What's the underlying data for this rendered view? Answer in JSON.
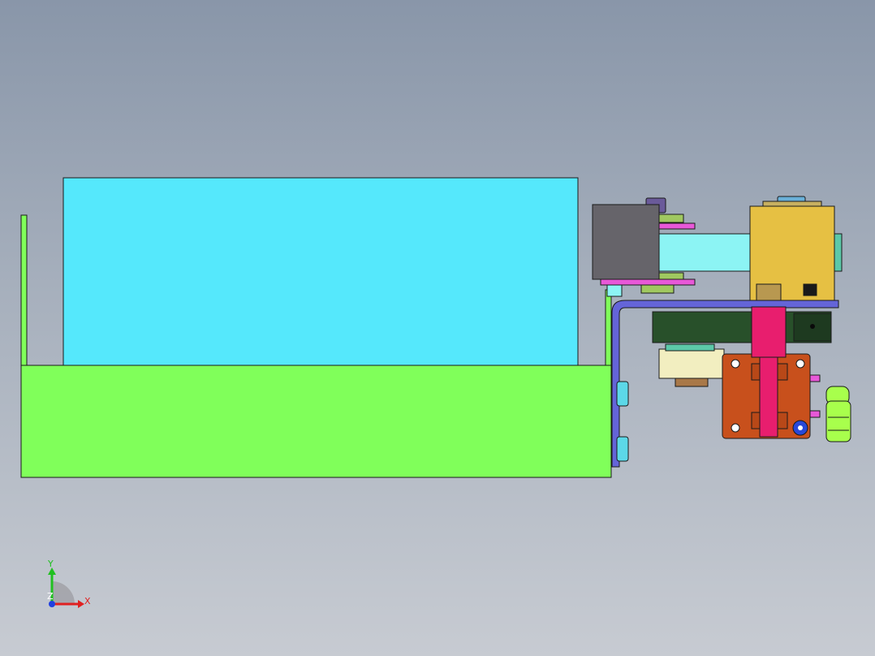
{
  "viewport": {
    "background_top": "#8996a9",
    "background_bottom": "#c7cbd2"
  },
  "triad": {
    "x_label": "X",
    "y_label": "Y",
    "z_label": "Z",
    "x_color": "#e02020",
    "y_color": "#20c020",
    "z_color": "#2040e0"
  },
  "parts": {
    "tray_color": "#80ff5a",
    "box_color": "#55e8fc",
    "bracket_color": "#6464d8",
    "dark_block_color": "#66646a",
    "yellow_block_color": "#e6c043",
    "cylinder_rod_color": "#e81e6e",
    "orange_block_color": "#c8501c",
    "green_plate_color": "#28502a",
    "fitting_color": "#a8ff4c"
  }
}
